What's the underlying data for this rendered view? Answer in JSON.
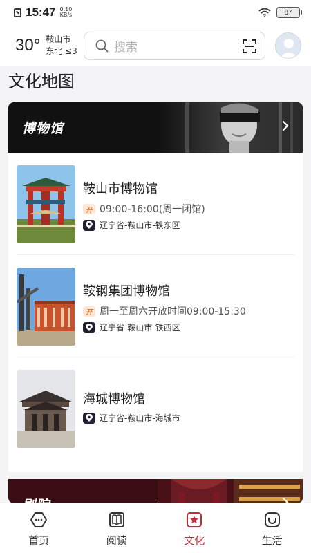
{
  "status_bar": {
    "time": "15:47",
    "net_speed_value": "0.10",
    "net_speed_unit": "KB/s",
    "battery": "87"
  },
  "header": {
    "temperature": "30°",
    "city": "鞍山市",
    "wind": "东北 ≤3",
    "search_placeholder": "搜索"
  },
  "page_title": "文化地图",
  "museum_section": {
    "category": "博物馆",
    "items": [
      {
        "name": "鞍山市博物馆",
        "hours": "09:00-16:00(周一闭馆)",
        "address": "辽宁省-鞍山市-铁东区"
      },
      {
        "name": "鞍钢集团博物馆",
        "hours": "周一至周六开放时间09:00-15:30",
        "address": "辽宁省-鞍山市-铁西区"
      },
      {
        "name": "海城博物馆",
        "hours": "",
        "address": "辽宁省-鞍山市-海城市"
      }
    ]
  },
  "theater_section": {
    "category": "剧院"
  },
  "open_badge": "开",
  "tabbar": {
    "tabs": [
      {
        "label": "首页",
        "icon": "home-icon"
      },
      {
        "label": "阅读",
        "icon": "book-icon"
      },
      {
        "label": "文化",
        "icon": "culture-icon"
      },
      {
        "label": "生活",
        "icon": "life-icon"
      }
    ],
    "active_color": "#c42b3a"
  }
}
